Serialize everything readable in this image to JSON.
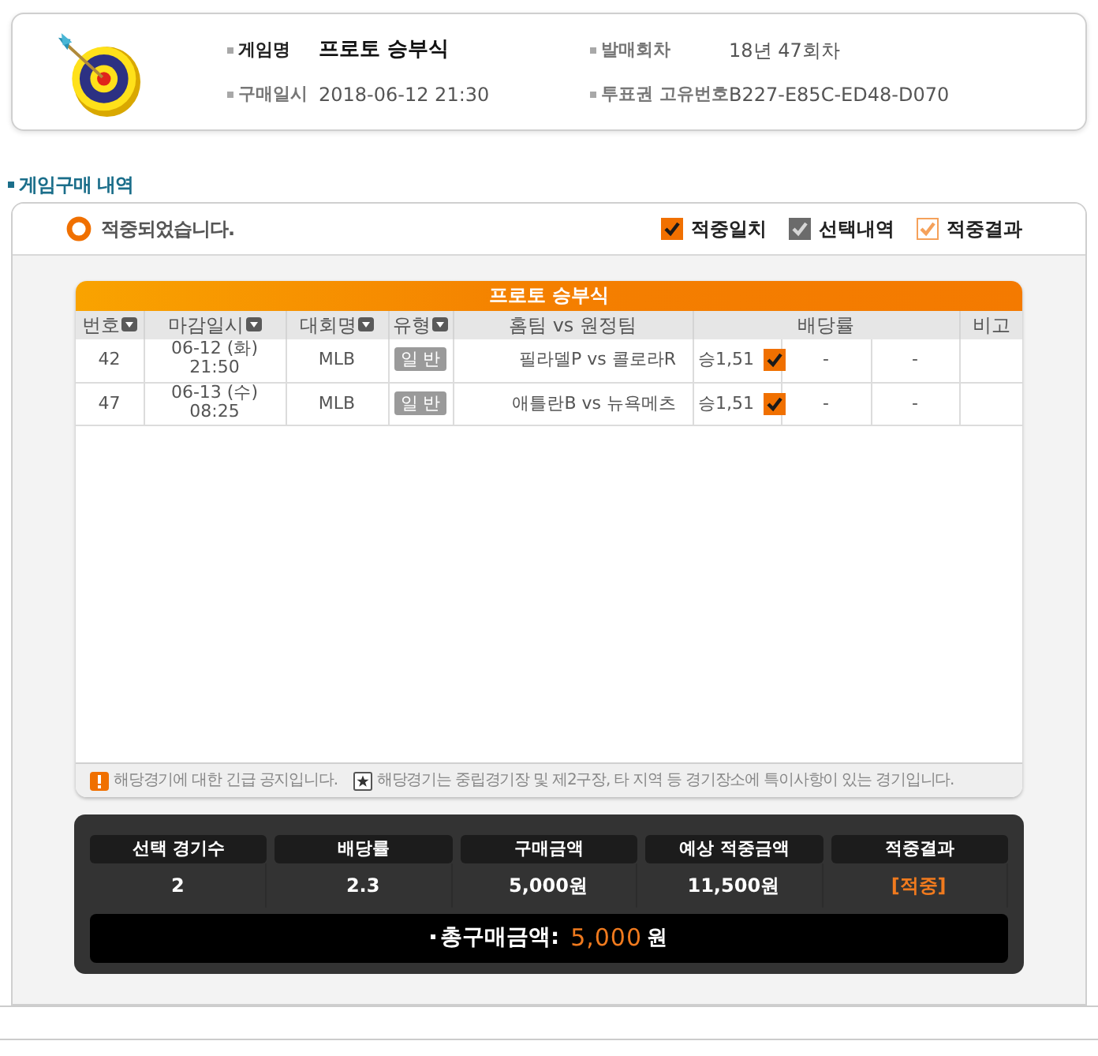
{
  "header": {
    "fields": [
      {
        "label": "게임명",
        "value": "프로토 승부식",
        "emphasis": true
      },
      {
        "label": "발매회차",
        "value": "18년 47회차",
        "emphasis": false
      },
      {
        "label": "구매일시",
        "value": "2018-06-12 21:30",
        "emphasis": false
      },
      {
        "label": "투표권 고유번호",
        "value": "B227-E85C-ED48-D070",
        "emphasis": false
      }
    ]
  },
  "section_title": "게임구매 내역",
  "status": {
    "text": "적중되었습니다."
  },
  "legend": [
    {
      "kind": "match",
      "label": "적중일치"
    },
    {
      "kind": "selected",
      "label": "선택내역"
    },
    {
      "kind": "result",
      "label": "적중결과"
    }
  ],
  "table": {
    "title": "프로토 승부식",
    "columns": [
      {
        "kind": "number",
        "label": "번호",
        "sortable": true
      },
      {
        "kind": "deadline",
        "label": "마감일시",
        "sortable": true
      },
      {
        "kind": "league",
        "label": "대회명",
        "sortable": true
      },
      {
        "kind": "type",
        "label": "유형",
        "sortable": true
      },
      {
        "kind": "matchup",
        "label": "홈팀 vs 원정팀",
        "sortable": false
      },
      {
        "kind": "odds",
        "label": "배당률",
        "sortable": false
      },
      {
        "kind": "note",
        "label": "비고",
        "sortable": false
      }
    ],
    "rows": [
      {
        "number": "42",
        "deadline_date": "06-12 (화)",
        "deadline_time": "21:50",
        "league": "MLB",
        "type": "일 반",
        "matchup": "필라델P vs 콜로라R",
        "odds": [
          {
            "text": "승1,51",
            "picked": true,
            "matched": true
          },
          {
            "text": "-",
            "picked": false,
            "matched": false
          },
          {
            "text": "-",
            "picked": false,
            "matched": false
          }
        ]
      },
      {
        "number": "47",
        "deadline_date": "06-13 (수)",
        "deadline_time": "08:25",
        "league": "MLB",
        "type": "일 반",
        "matchup": "애틀란B vs 뉴욕메츠",
        "odds": [
          {
            "text": "승1,51",
            "picked": true,
            "matched": true
          },
          {
            "text": "-",
            "picked": false,
            "matched": false
          },
          {
            "text": "-",
            "picked": false,
            "matched": false
          }
        ]
      }
    ]
  },
  "notices": [
    {
      "kind": "urgent",
      "text": "해당경기에 대한 긴급 공지입니다."
    },
    {
      "kind": "venue",
      "text": "해당경기는 중립경기장 및 제2구장, 타 지역 등 경기장소에 특이사항이 있는 경기입니다."
    }
  ],
  "summary": {
    "items": [
      {
        "label": "선택 경기수",
        "value": "2",
        "highlight": false
      },
      {
        "label": "배당률",
        "value": "2.3",
        "highlight": false
      },
      {
        "label": "구매금액",
        "value": "5,000원",
        "highlight": false
      },
      {
        "label": "예상 적중금액",
        "value": "11,500원",
        "highlight": false
      },
      {
        "label": "적중결과",
        "value": "[적중]",
        "highlight": true
      }
    ],
    "total": {
      "label": "총구매금액:",
      "amount": "5,000",
      "unit": "원"
    }
  }
}
